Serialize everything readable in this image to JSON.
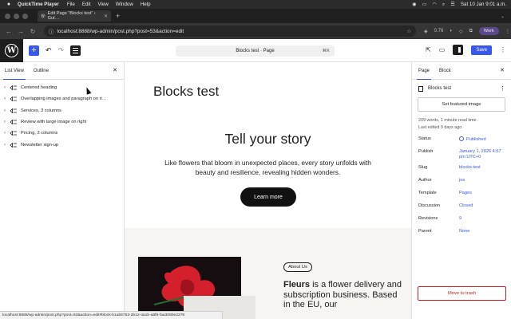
{
  "menubar": {
    "app_name": "QuickTime Player",
    "items": [
      "File",
      "Edit",
      "View",
      "Window",
      "Help"
    ],
    "clock": "Sat 10 Jan  9:01 a.m."
  },
  "browser": {
    "tab_title": "Edit Page “Blocks test” ‹ Gut…",
    "url": "localhost:8888/wp-admin/post.php?post=53&action=edit",
    "profile": "Work",
    "extension_badge": "0.76"
  },
  "wp_header": {
    "doc_title": "Blocks test · Page",
    "doc_shortcut": "⌘K",
    "save_label": "Save"
  },
  "list_view": {
    "tabs": [
      "List View",
      "Outline"
    ],
    "items": [
      "Centered heading",
      "Overlapping images and paragraph on ri…",
      "Services, 3 columns",
      "Review with large image on right",
      "Pricing, 2 columns",
      "Newsletter sign-up"
    ]
  },
  "canvas": {
    "post_title": "Blocks test",
    "hero_title": "Tell your story",
    "hero_text": "Like flowers that bloom in unexpected places, every story unfolds with beauty and resilience, revealing hidden wonders.",
    "hero_button": "Learn more",
    "about_pill": "About Us",
    "fleurs_bold": "Fleurs",
    "fleurs_rest": " is a flower delivery and subscription business. Based in the EU, our"
  },
  "settings": {
    "tabs": [
      "Page",
      "Block"
    ],
    "doc_name": "Blocks test",
    "featured_button": "Set featured image",
    "meta_line1": "209 words, 1 minute read time.",
    "meta_line2": "Last edited 9 days ago.",
    "rows": [
      {
        "key": "Status",
        "value": "Published"
      },
      {
        "key": "Publish",
        "value": "January 1, 2026 4:57 pm UTC+0"
      },
      {
        "key": "Slug",
        "value": "blocks-test"
      },
      {
        "key": "Author",
        "value": "jos"
      },
      {
        "key": "Template",
        "value": "Pages"
      },
      {
        "key": "Discussion",
        "value": "Closed"
      },
      {
        "key": "Revisions",
        "value": "9"
      },
      {
        "key": "Parent",
        "value": "None"
      }
    ],
    "trash_button": "Move to trash"
  },
  "status_url": "localhost:8888/wp-admin/post.php?post=53&action=edit#block-b1ab9753-2b12-4a1b-a8f8-faa3080e2278",
  "colors": {
    "accent": "#3858e9",
    "danger": "#cc1818",
    "dark": "#1e1e1e"
  }
}
